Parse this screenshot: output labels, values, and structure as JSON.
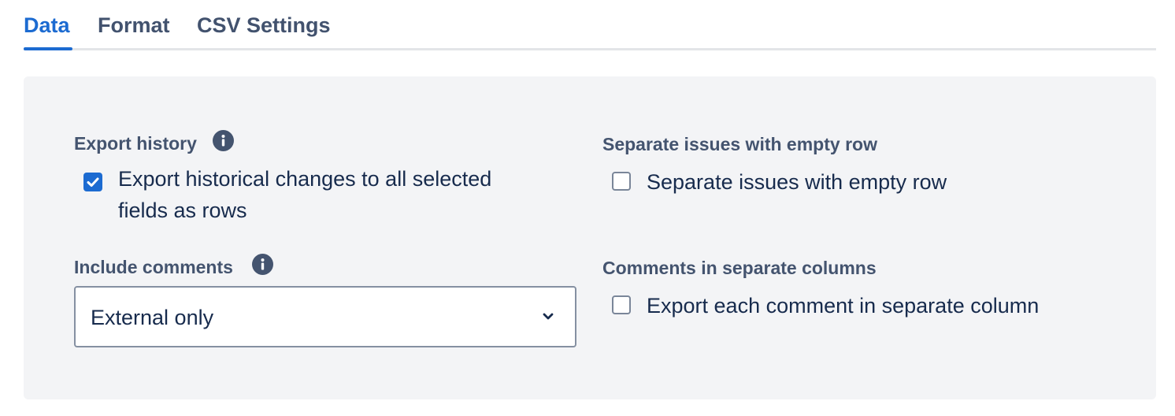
{
  "tabs": {
    "data": "Data",
    "format": "Format",
    "csv_settings": "CSV Settings",
    "active": "Data"
  },
  "export_history": {
    "label": "Export history",
    "checkbox_label": "Export historical changes to all selected fields as rows",
    "checked": true
  },
  "separate_issues": {
    "label": "Separate issues with empty row",
    "checkbox_label": "Separate issues with empty row",
    "checked": false
  },
  "include_comments": {
    "label": "Include comments",
    "selected_value": "External only"
  },
  "comments_columns": {
    "label": "Comments in separate columns",
    "checkbox_label": "Export each comment in separate column",
    "checked": false
  },
  "colors": {
    "accent": "#1c6bd1",
    "label": "#44546f",
    "text": "#172b4d",
    "panel_bg": "#f3f4f6"
  }
}
